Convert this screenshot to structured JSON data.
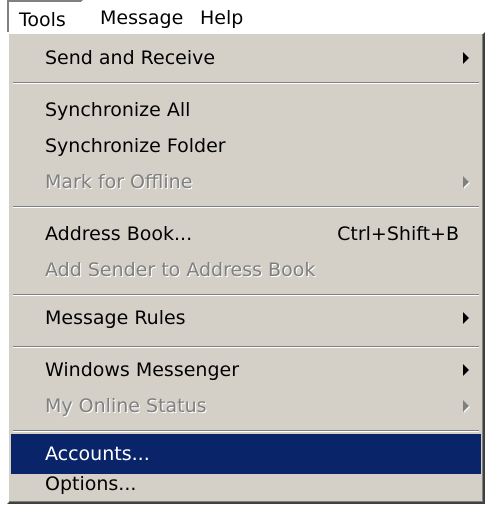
{
  "menubar": {
    "tools_label": "Tools",
    "message_label": "Message",
    "help_label": "Help"
  },
  "menu": {
    "send_receive": "Send and Receive",
    "synchronize_all": "Synchronize All",
    "synchronize_folder": "Synchronize Folder",
    "mark_offline": "Mark for Offline",
    "address_book": "Address Book...",
    "address_book_shortcut": "Ctrl+Shift+B",
    "add_sender": "Add Sender to Address Book",
    "message_rules": "Message Rules",
    "windows_messenger": "Windows Messenger",
    "online_status": "My Online Status",
    "accounts": "Accounts...",
    "options": "Options..."
  },
  "colors": {
    "menu_bg": "#d4d0c8",
    "highlight": "#0a246a",
    "disabled_text": "#808080"
  }
}
